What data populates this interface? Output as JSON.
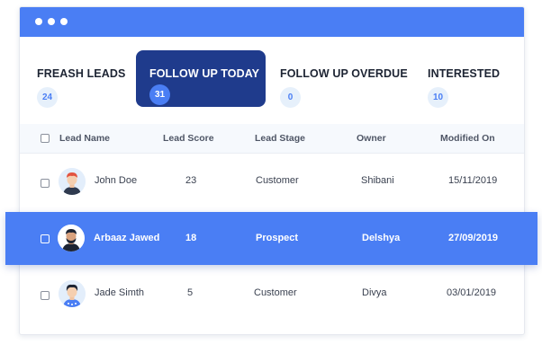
{
  "tabs": [
    {
      "label": "FREASH LEADS",
      "count": "24",
      "active": false
    },
    {
      "label": "FOLLOW UP TODAY",
      "count": "31",
      "active": true
    },
    {
      "label": "FOLLOW UP OVERDUE",
      "count": "0",
      "active": false
    },
    {
      "label": "INTERESTED",
      "count": "10",
      "active": false
    }
  ],
  "table": {
    "headers": [
      "Lead Name",
      "Lead Score",
      "Lead Stage",
      "Owner",
      "Modified On"
    ],
    "rows": [
      {
        "name": "John Doe",
        "score": "23",
        "stage": "Customer",
        "owner": "Shibani",
        "modified": "15/11/2019",
        "selected": false
      },
      {
        "name": "Arbaaz Jawed",
        "score": "18",
        "stage": "Prospect",
        "owner": "Delshya",
        "modified": "27/09/2019",
        "selected": true
      },
      {
        "name": "Jade Simth",
        "score": "5",
        "stage": "Customer",
        "owner": "Divya",
        "modified": "03/01/2019",
        "selected": false
      }
    ]
  },
  "colors": {
    "accent": "#4a7ef4",
    "active_tab": "#1f3b8c",
    "count_bg": "#e6f0fb",
    "header_bg": "#f6f9fd"
  },
  "icons": {
    "window_dots": "three-dots-icon",
    "avatars": [
      "avatar-john-doe",
      "avatar-arbaaz-jawed",
      "avatar-jade-simth"
    ]
  }
}
